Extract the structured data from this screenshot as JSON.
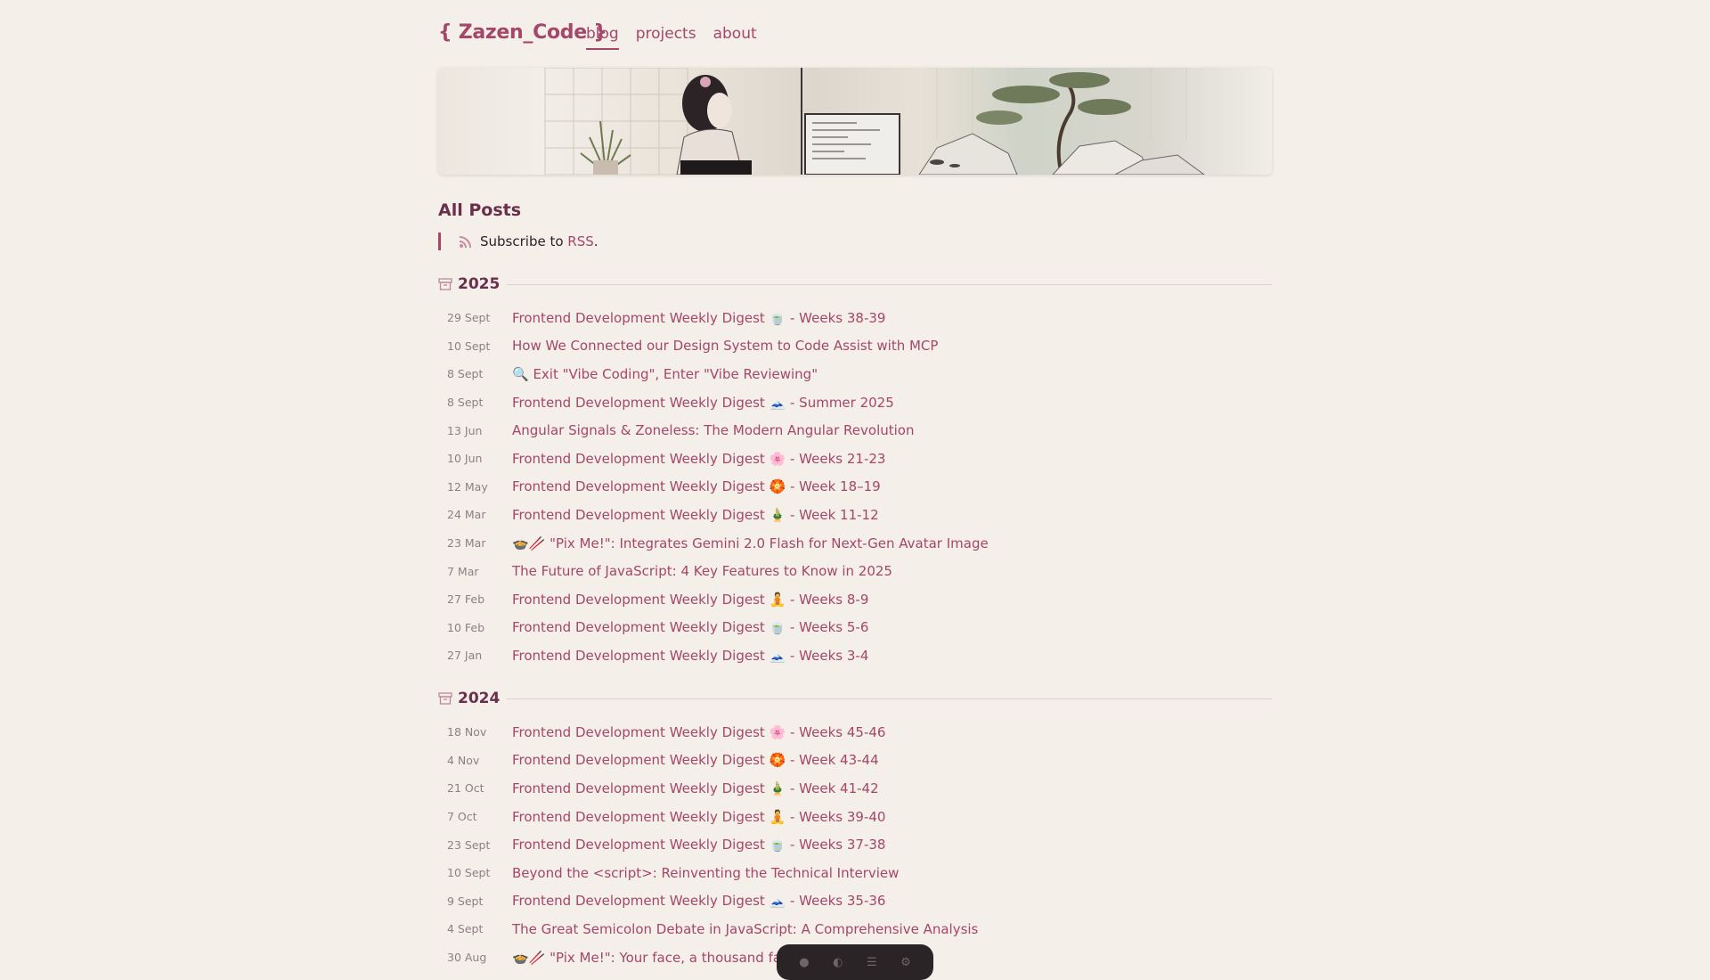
{
  "brand": "{ Zazen_Code }",
  "nav": [
    "blog",
    "projects",
    "about"
  ],
  "section_title": "All Posts",
  "rss": {
    "prefix": "Subscribe to ",
    "link": "RSS",
    "suffix": "."
  },
  "years": [
    {
      "year": "2025",
      "posts": [
        {
          "date": "29 Sept",
          "title": "Frontend Development Weekly Digest 🍵 - Weeks 38-39"
        },
        {
          "date": "10 Sept",
          "title": "How We Connected our Design System to Code Assist with MCP"
        },
        {
          "date": "8 Sept",
          "title": "🔍 Exit \"Vibe Coding\", Enter \"Vibe Reviewing\""
        },
        {
          "date": "8 Sept",
          "title": "Frontend Development Weekly Digest 🗻 - Summer 2025"
        },
        {
          "date": "13 Jun",
          "title": "Angular Signals & Zoneless: The Modern Angular Revolution"
        },
        {
          "date": "10 Jun",
          "title": "Frontend Development Weekly Digest 🌸 - Weeks 21-23"
        },
        {
          "date": "12 May",
          "title": "Frontend Development Weekly Digest 🏵️ - Week 18–19"
        },
        {
          "date": "24 Mar",
          "title": "Frontend Development Weekly Digest 🎍 - Week 11-12"
        },
        {
          "date": "23 Mar",
          "title": "🍲🥢 \"Pix Me!\": Integrates Gemini 2.0 Flash for Next-Gen Avatar Image"
        },
        {
          "date": "7 Mar",
          "title": "The Future of JavaScript: 4 Key Features to Know in 2025"
        },
        {
          "date": "27 Feb",
          "title": "Frontend Development Weekly Digest 🧘 - Weeks 8-9"
        },
        {
          "date": "10 Feb",
          "title": "Frontend Development Weekly Digest 🍵 - Weeks 5-6"
        },
        {
          "date": "27 Jan",
          "title": "Frontend Development Weekly Digest 🗻 - Weeks 3-4"
        }
      ]
    },
    {
      "year": "2024",
      "posts": [
        {
          "date": "18 Nov",
          "title": "Frontend Development Weekly Digest 🌸 - Weeks 45-46"
        },
        {
          "date": "4 Nov",
          "title": "Frontend Development Weekly Digest 🏵️ - Week 43-44"
        },
        {
          "date": "21 Oct",
          "title": "Frontend Development Weekly Digest 🎍 - Week 41-42"
        },
        {
          "date": "7 Oct",
          "title": "Frontend Development Weekly Digest 🧘 - Weeks 39-40"
        },
        {
          "date": "23 Sept",
          "title": "Frontend Development Weekly Digest 🍵 - Weeks 37-38"
        },
        {
          "date": "10 Sept",
          "title": "Beyond the <script>: Reinventing the Technical Interview"
        },
        {
          "date": "9 Sept",
          "title": "Frontend Development Weekly Digest 🗻 - Weeks 35-36"
        },
        {
          "date": "4 Sept",
          "title": "The Great Semicolon Debate in JavaScript: A Comprehensive Analysis"
        },
        {
          "date": "30 Aug",
          "title": "🍲🥢 \"Pix Me!\": Your face, a thousand fac"
        }
      ]
    }
  ],
  "colors": {
    "accent": "#a4476a",
    "heading": "#6a2f4a",
    "background": "#f4efe9",
    "date": "#8e7f84"
  },
  "icons": {
    "rss": "rss-icon",
    "archive": "archive-box-icon"
  }
}
